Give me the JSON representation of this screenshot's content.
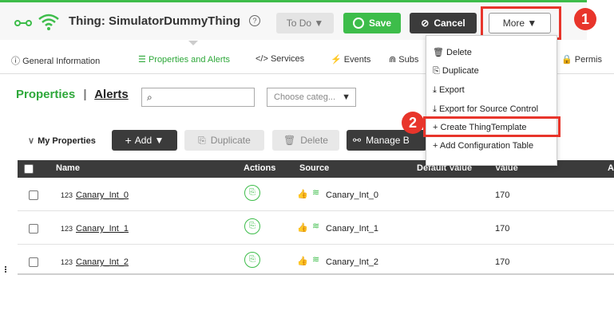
{
  "header": {
    "title": "Thing: SimulatorDummyThing",
    "todo_label": "To Do",
    "save_label": "Save",
    "cancel_label": "Cancel",
    "more_label": "More"
  },
  "callouts": {
    "one": "1",
    "two": "2"
  },
  "tabs": [
    {
      "label": "General Information"
    },
    {
      "label": "Properties and Alerts"
    },
    {
      "label": "Services"
    },
    {
      "label": "Events"
    },
    {
      "label": "Subs"
    },
    {
      "label": "Permis"
    }
  ],
  "section": {
    "properties": "Properties",
    "separator": "|",
    "alerts": "Alerts",
    "category_placeholder": "Choose categ..."
  },
  "toolbar": {
    "group_label": "My Properties",
    "add_label": "Add",
    "duplicate_label": "Duplicate",
    "delete_label": "Delete",
    "manage_label": "Manage B"
  },
  "table": {
    "columns": {
      "name": "Name",
      "actions": "Actions",
      "source": "Source",
      "default_value": "Default Value",
      "value": "Value",
      "extra": "A"
    },
    "rows": [
      {
        "type": "123",
        "name": "Canary_Int_0",
        "source": "Canary_Int_0",
        "value": "170"
      },
      {
        "type": "123",
        "name": "Canary_Int_1",
        "source": "Canary_Int_1",
        "value": "170"
      },
      {
        "type": "123",
        "name": "Canary_Int_2",
        "source": "Canary_Int_2",
        "value": "170"
      }
    ]
  },
  "menu": {
    "items": [
      {
        "label": "Delete"
      },
      {
        "label": "Duplicate"
      },
      {
        "label": "Export"
      },
      {
        "label": "Export for Source Control"
      },
      {
        "label": "Create ThingTemplate"
      },
      {
        "label": "Add Configuration Table"
      }
    ]
  },
  "colors": {
    "accent": "#3dbd4a",
    "dark": "#3b3b3b",
    "callout": "#e8352b"
  }
}
